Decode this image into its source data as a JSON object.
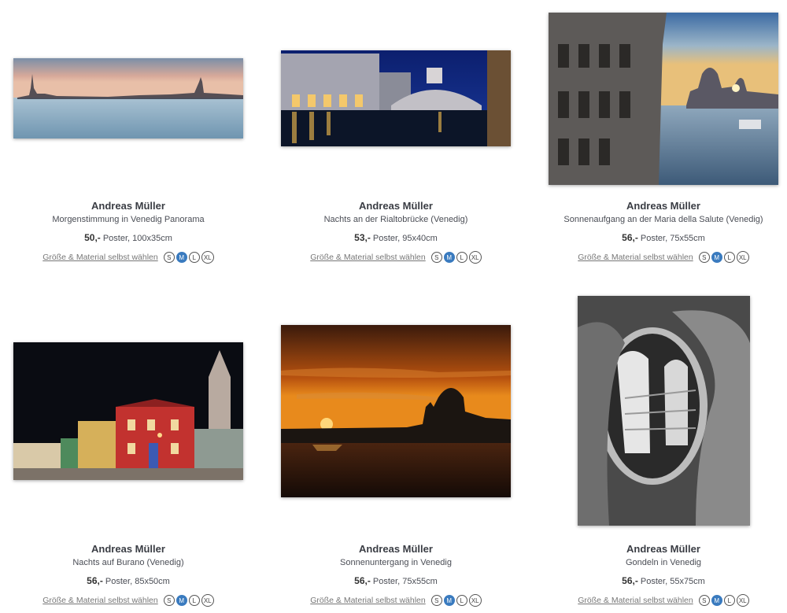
{
  "ui": {
    "choose_label": "Größe & Material selbst wählen",
    "sizes": [
      "S",
      "M",
      "L",
      "XL"
    ],
    "active_size": "M",
    "accent_color": "#3a7bbf"
  },
  "products": [
    {
      "artist": "Andreas Müller",
      "title": "Morgenstimmung in Venedig Panorama",
      "price": "50,-",
      "detail": "Poster, 100x35cm",
      "image": "venice-morning-panorama"
    },
    {
      "artist": "Andreas Müller",
      "title": "Nachts an der Rialtobrücke (Venedig)",
      "price": "53,-",
      "detail": "Poster, 95x40cm",
      "image": "rialto-bridge-night"
    },
    {
      "artist": "Andreas Müller",
      "title": "Sonnenaufgang an der Maria della Salute (Venedig)",
      "price": "56,-",
      "detail": "Poster, 75x55cm",
      "image": "salute-sunrise"
    },
    {
      "artist": "Andreas Müller",
      "title": "Nachts auf Burano (Venedig)",
      "price": "56,-",
      "detail": "Poster, 85x50cm",
      "image": "burano-night"
    },
    {
      "artist": "Andreas Müller",
      "title": "Sonnenuntergang in Venedig",
      "price": "56,-",
      "detail": "Poster, 75x55cm",
      "image": "venice-sunset"
    },
    {
      "artist": "Andreas Müller",
      "title": "Gondeln in Venedig",
      "price": "56,-",
      "detail": "Poster, 55x75cm",
      "image": "gondolas-bw"
    }
  ]
}
